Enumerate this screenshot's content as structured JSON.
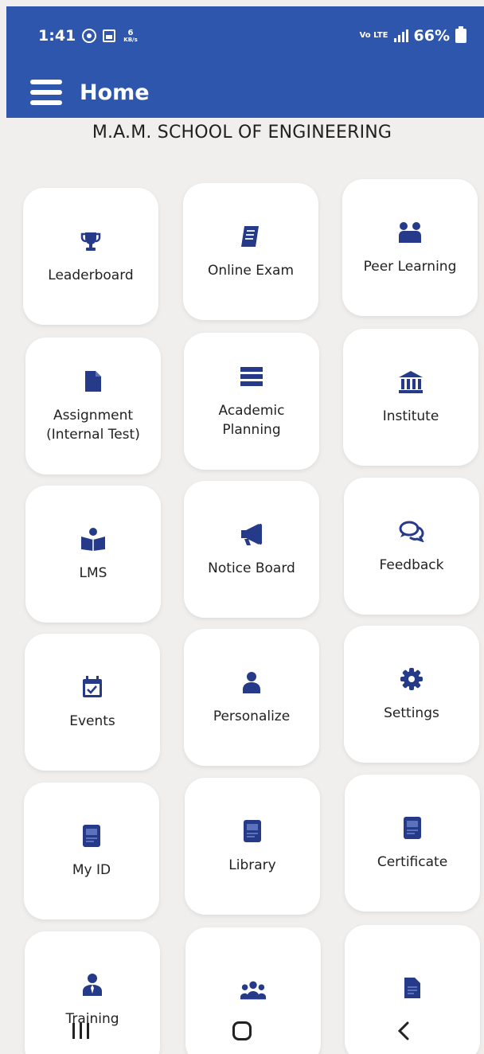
{
  "status_bar": {
    "time": "1:41",
    "left_icons": [
      "whatsapp-icon",
      "image-icon"
    ],
    "speed_value": "6",
    "speed_unit": "KB/s",
    "network": "Vo LTE",
    "battery": "66%"
  },
  "header": {
    "title": "Home",
    "menu_icon": "hamburger-icon"
  },
  "school_name": "M.A.M. SCHOOL OF ENGINEERING",
  "colors": {
    "primary": "#2f56ad",
    "icon": "#263a8a",
    "background": "#f1efed",
    "card": "#ffffff"
  },
  "tiles": [
    {
      "label": "Leaderboard",
      "icon": "trophy-icon"
    },
    {
      "label": "Online Exam",
      "icon": "book-icon"
    },
    {
      "label": "Peer Learning",
      "icon": "peer-learning-icon"
    },
    {
      "label": "Assignment\n(Internal Test)",
      "icon": "document-icon"
    },
    {
      "label": "Academic\nPlanning",
      "icon": "list-lines-icon"
    },
    {
      "label": "Institute",
      "icon": "institute-icon"
    },
    {
      "label": "LMS",
      "icon": "reader-icon"
    },
    {
      "label": "Notice Board",
      "icon": "megaphone-icon"
    },
    {
      "label": "Feedback",
      "icon": "chat-icon"
    },
    {
      "label": "Events",
      "icon": "calendar-check-icon"
    },
    {
      "label": "Personalize",
      "icon": "person-icon"
    },
    {
      "label": "Settings",
      "icon": "gear-icon"
    },
    {
      "label": "My ID",
      "icon": "id-book-icon"
    },
    {
      "label": "Library",
      "icon": "library-book-icon"
    },
    {
      "label": "Certificate",
      "icon": "certificate-icon"
    },
    {
      "label": "Training",
      "icon": "trainer-icon"
    },
    {
      "label": "",
      "icon": "group-icon"
    },
    {
      "label": "",
      "icon": "file-icon"
    }
  ],
  "navbar": {
    "recent": "recent-apps-icon",
    "home": "home-icon",
    "back": "back-icon"
  }
}
